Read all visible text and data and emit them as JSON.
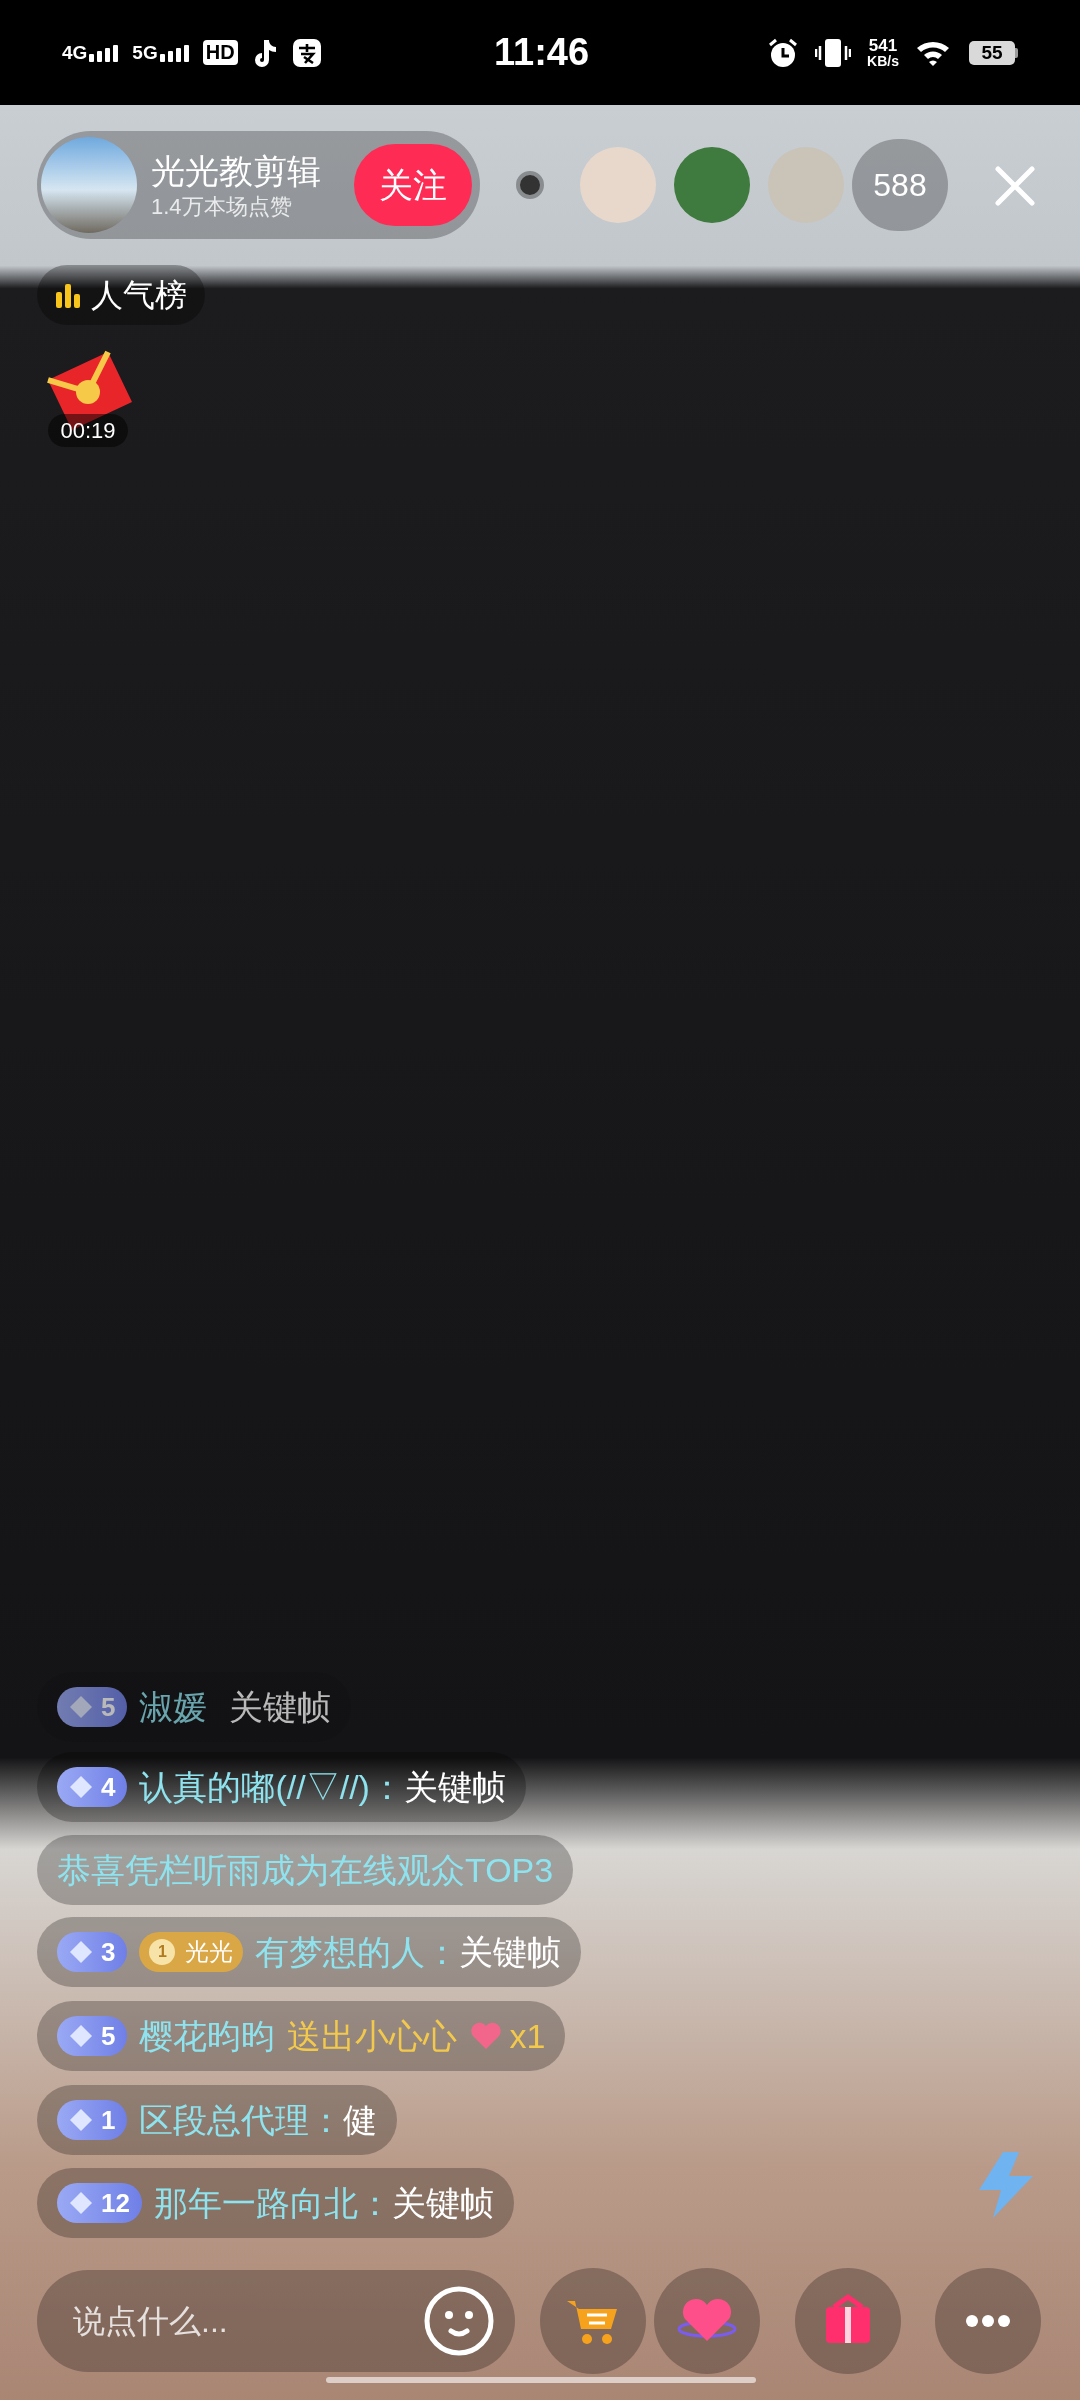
{
  "status_bar": {
    "networks": [
      "4G",
      "5G"
    ],
    "hd": "HD",
    "time": "11:46",
    "speed_value": "541",
    "speed_unit": "KB/s",
    "battery": "55"
  },
  "header": {
    "streamer_name": "光光教剪辑",
    "likes": "1.4万本场点赞",
    "follow_button": "关注",
    "viewer_count": "588"
  },
  "ranking_badge": "人气榜",
  "red_packet_timer": "00:19",
  "comments": [
    {
      "kind": "chat",
      "faded": true,
      "level": "5",
      "user": "淑媛",
      "text": "关键帧"
    },
    {
      "kind": "chat",
      "faded": false,
      "level": "4",
      "user": "认真的嘟(//▽//)：",
      "text": "关键帧"
    },
    {
      "kind": "system",
      "faded": false,
      "text": "恭喜凭栏听雨成为在线观众TOP3"
    },
    {
      "kind": "chat",
      "faded": false,
      "level": "3",
      "fan_badge": {
        "level": "1",
        "name": "光光"
      },
      "user": "有梦想的人：",
      "text": "关键帧"
    },
    {
      "kind": "gift",
      "faded": false,
      "level": "5",
      "user": "樱花昀昀",
      "text": "送出小心心",
      "count": "x1"
    },
    {
      "kind": "chat",
      "faded": false,
      "level": "1",
      "user": "区段总代理：",
      "text": "健"
    },
    {
      "kind": "chat",
      "faded": false,
      "level": "12",
      "user": "那年一路向北：",
      "text": "关键帧"
    }
  ],
  "input": {
    "placeholder": "说点什么..."
  }
}
